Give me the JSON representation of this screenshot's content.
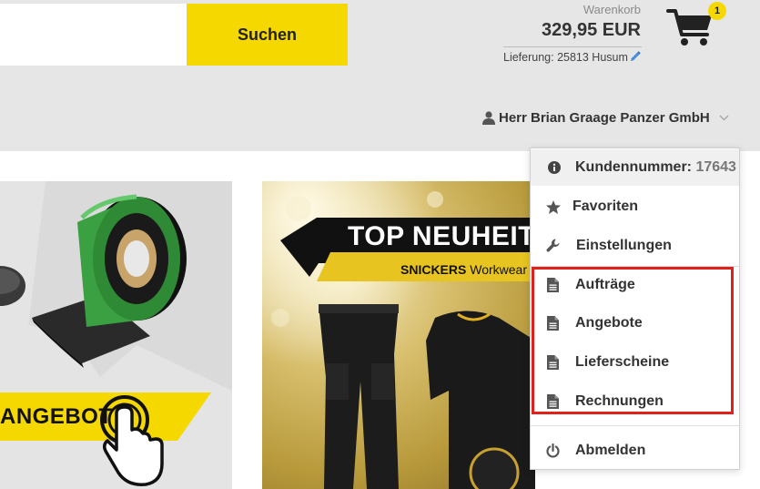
{
  "search": {
    "value": "",
    "placeholder": "",
    "button_label": "Suchen"
  },
  "cart": {
    "label": "Warenkorb",
    "total": "329,95 EUR",
    "badge_count": "1",
    "delivery": "Lieferung: 25813 Husum"
  },
  "user": {
    "name": "Herr Brian Graage Panzer GmbH"
  },
  "dropdown": {
    "customer_label": "Kundennummer:",
    "customer_number": "17643",
    "items": [
      {
        "label": "Favoriten",
        "icon": "star-icon"
      },
      {
        "label": "Einstellungen",
        "icon": "wrench-icon"
      },
      {
        "label": "Aufträge",
        "icon": "document-icon"
      },
      {
        "label": "Angebote",
        "icon": "document-icon"
      },
      {
        "label": "Lieferscheine",
        "icon": "document-icon"
      },
      {
        "label": "Rechnungen",
        "icon": "document-icon"
      }
    ],
    "logout_label": "Abmelden"
  },
  "banners": {
    "left_label": "ANGEBOT",
    "center_title": "TOP NEUHEIT",
    "center_brand": "SNICKERS",
    "center_subtitle": "Workwear"
  },
  "colors": {
    "accent_yellow": "#f5d800",
    "highlight_red": "#e0201b",
    "header_bg": "#e6e6e6"
  }
}
